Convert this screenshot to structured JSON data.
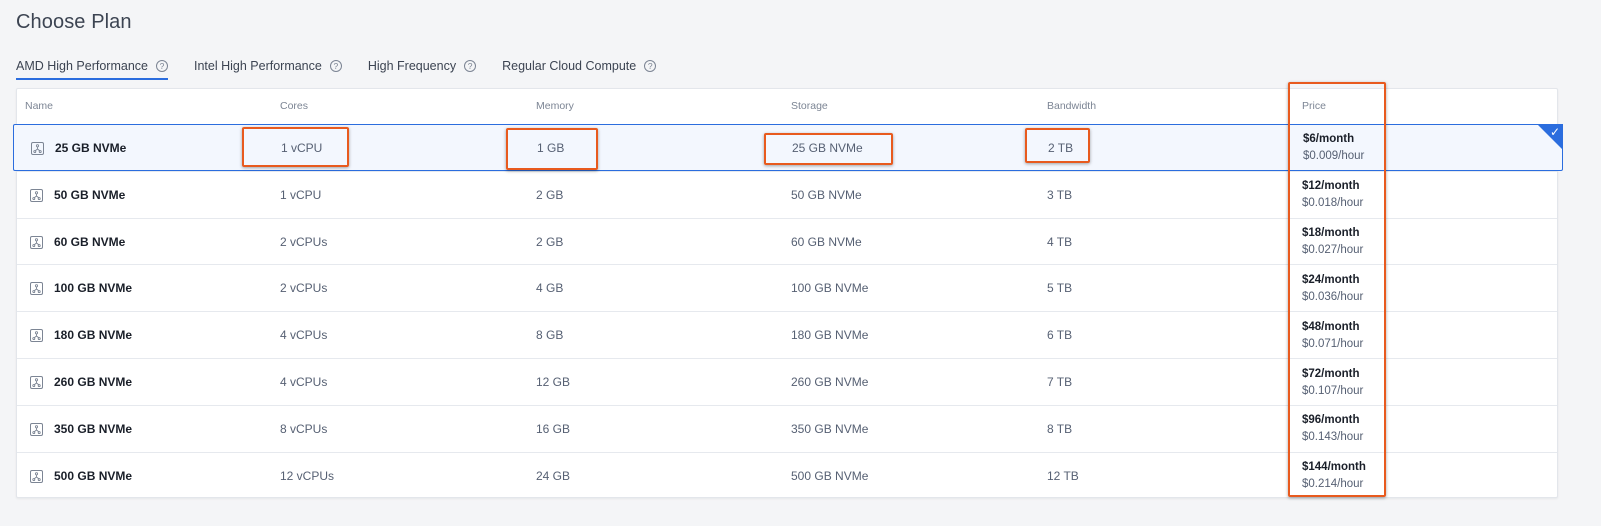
{
  "page_title": "Choose Plan",
  "tabs": [
    {
      "label": "AMD High Performance",
      "active": true
    },
    {
      "label": "Intel High Performance",
      "active": false
    },
    {
      "label": "High Frequency",
      "active": false
    },
    {
      "label": "Regular Cloud Compute",
      "active": false
    }
  ],
  "help_glyph": "?",
  "columns": {
    "name": "Name",
    "cores": "Cores",
    "memory": "Memory",
    "storage": "Storage",
    "bandwidth": "Bandwidth",
    "price": "Price"
  },
  "plans": [
    {
      "name": "25 GB NVMe",
      "cores": "1 vCPU",
      "memory": "1 GB",
      "storage": "25 GB NVMe",
      "bandwidth": "2 TB",
      "price_month": "$6/month",
      "price_hour": "$0.009/hour",
      "selected": true
    },
    {
      "name": "50 GB NVMe",
      "cores": "1 vCPU",
      "memory": "2 GB",
      "storage": "50 GB NVMe",
      "bandwidth": "3 TB",
      "price_month": "$12/month",
      "price_hour": "$0.018/hour",
      "selected": false
    },
    {
      "name": "60 GB NVMe",
      "cores": "2 vCPUs",
      "memory": "2 GB",
      "storage": "60 GB NVMe",
      "bandwidth": "4 TB",
      "price_month": "$18/month",
      "price_hour": "$0.027/hour",
      "selected": false
    },
    {
      "name": "100 GB NVMe",
      "cores": "2 vCPUs",
      "memory": "4 GB",
      "storage": "100 GB NVMe",
      "bandwidth": "5 TB",
      "price_month": "$24/month",
      "price_hour": "$0.036/hour",
      "selected": false
    },
    {
      "name": "180 GB NVMe",
      "cores": "4 vCPUs",
      "memory": "8 GB",
      "storage": "180 GB NVMe",
      "bandwidth": "6 TB",
      "price_month": "$48/month",
      "price_hour": "$0.071/hour",
      "selected": false
    },
    {
      "name": "260 GB NVMe",
      "cores": "4 vCPUs",
      "memory": "12 GB",
      "storage": "260 GB NVMe",
      "bandwidth": "7 TB",
      "price_month": "$72/month",
      "price_hour": "$0.107/hour",
      "selected": false
    },
    {
      "name": "350 GB NVMe",
      "cores": "8 vCPUs",
      "memory": "16 GB",
      "storage": "350 GB NVMe",
      "bandwidth": "8 TB",
      "price_month": "$96/month",
      "price_hour": "$0.143/hour",
      "selected": false
    },
    {
      "name": "500 GB NVMe",
      "cores": "12 vCPUs",
      "memory": "24 GB",
      "storage": "500 GB NVMe",
      "bandwidth": "12 TB",
      "price_month": "$144/month",
      "price_hour": "$0.214/hour",
      "selected": false
    }
  ],
  "icons": {
    "row_icon": "ssd-chip-icon",
    "help_icon": "question-circle-icon",
    "selected_icon": "checkmark-icon"
  },
  "colors": {
    "accent": "#2b6dde",
    "highlight": "#e85a1e",
    "selected_row_bg": "#f3f7fe"
  }
}
